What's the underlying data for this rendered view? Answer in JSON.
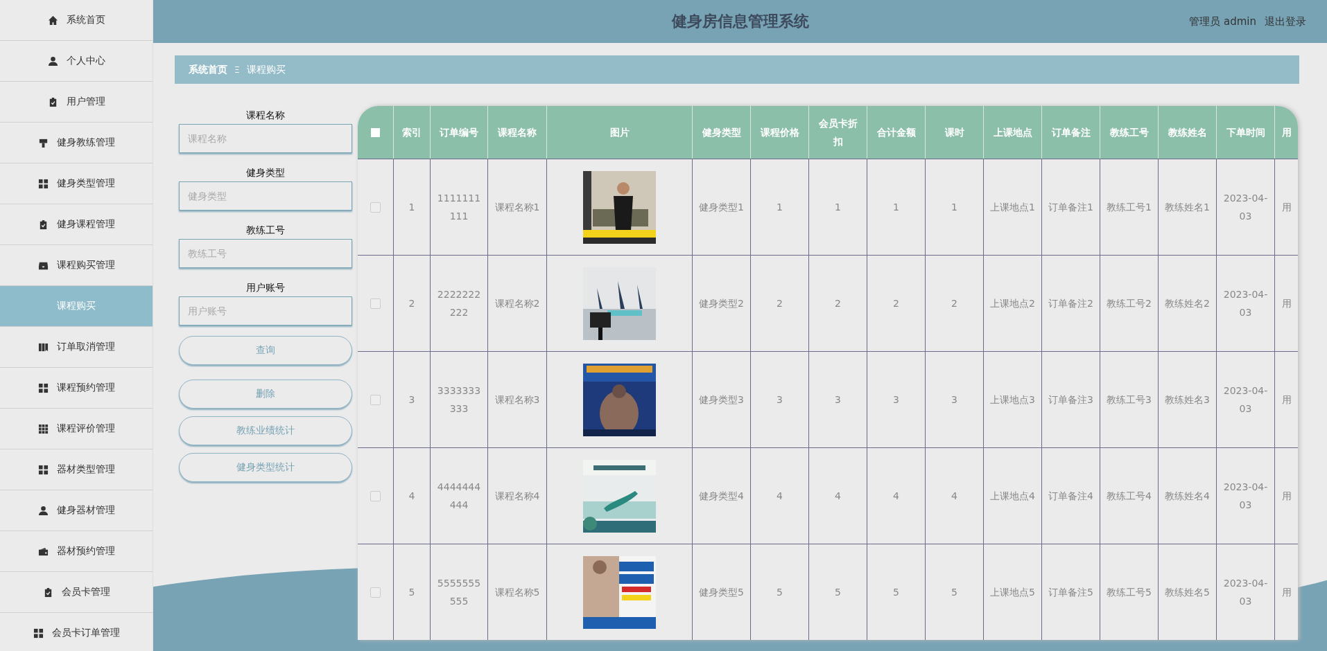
{
  "sidebar": {
    "items": [
      {
        "label": "系统首页",
        "selected": false
      },
      {
        "label": "个人中心",
        "selected": false
      },
      {
        "label": "用户管理",
        "selected": false
      },
      {
        "label": "健身教练管理",
        "selected": false
      },
      {
        "label": "健身类型管理",
        "selected": false
      },
      {
        "label": "健身课程管理",
        "selected": false
      },
      {
        "label": "课程购买管理",
        "selected": false
      },
      {
        "label": "课程购买",
        "selected": true
      },
      {
        "label": "订单取消管理",
        "selected": false
      },
      {
        "label": "课程预约管理",
        "selected": false
      },
      {
        "label": "课程评价管理",
        "selected": false
      },
      {
        "label": "器材类型管理",
        "selected": false
      },
      {
        "label": "健身器材管理",
        "selected": false
      },
      {
        "label": "器材预约管理",
        "selected": false
      },
      {
        "label": "会员卡管理",
        "selected": false
      },
      {
        "label": "会员卡订单管理",
        "selected": false
      }
    ]
  },
  "header": {
    "title": "健身房信息管理系统",
    "user": "管理员 admin",
    "logout": "退出登录"
  },
  "breadcrumb": {
    "items": [
      "系统首页",
      "课程购买"
    ],
    "separator": "Ξ"
  },
  "search": {
    "fields": [
      {
        "label": "课程名称",
        "placeholder": "课程名称"
      },
      {
        "label": "健身类型",
        "placeholder": "健身类型"
      },
      {
        "label": "教练工号",
        "placeholder": "教练工号"
      },
      {
        "label": "用户账号",
        "placeholder": "用户账号"
      }
    ],
    "buttons": [
      "查询",
      "删除",
      "教练业绩统计",
      "健身类型统计"
    ]
  },
  "table": {
    "select_all_checked": false,
    "columns": [
      "索引",
      "订单编号",
      "课程名称",
      "图片",
      "健身类型",
      "课程价格",
      "会员卡折扣",
      "合计金额",
      "课时",
      "上课地点",
      "订单备注",
      "教练工号",
      "教练姓名",
      "下单时间",
      "用"
    ],
    "rows": [
      {
        "checked": false,
        "cells": [
          "1",
          "1111111111",
          "课程名称1",
          "",
          "健身类型1",
          "1",
          "1",
          "1",
          "1",
          "上课地点1",
          "订单备注1",
          "教练工号1",
          "教练姓名1",
          "2023-04-03",
          "用"
        ]
      },
      {
        "checked": false,
        "cells": [
          "2",
          "2222222222",
          "课程名称2",
          "",
          "健身类型2",
          "2",
          "2",
          "2",
          "2",
          "上课地点2",
          "订单备注2",
          "教练工号2",
          "教练姓名2",
          "2023-04-03",
          "用"
        ]
      },
      {
        "checked": false,
        "cells": [
          "3",
          "3333333333",
          "课程名称3",
          "",
          "健身类型3",
          "3",
          "3",
          "3",
          "3",
          "上课地点3",
          "订单备注3",
          "教练工号3",
          "教练姓名3",
          "2023-04-03",
          "用"
        ]
      },
      {
        "checked": false,
        "cells": [
          "4",
          "4444444444",
          "课程名称4",
          "",
          "健身类型4",
          "4",
          "4",
          "4",
          "4",
          "上课地点4",
          "订单备注4",
          "教练工号4",
          "教练姓名4",
          "2023-04-03",
          "用"
        ]
      },
      {
        "checked": false,
        "cells": [
          "5",
          "5555555555",
          "课程名称5",
          "",
          "健身类型5",
          "5",
          "5",
          "5",
          "5",
          "上课地点5",
          "订单备注5",
          "教练工号5",
          "教练姓名5",
          "2023-04-03",
          "用"
        ]
      }
    ]
  }
}
